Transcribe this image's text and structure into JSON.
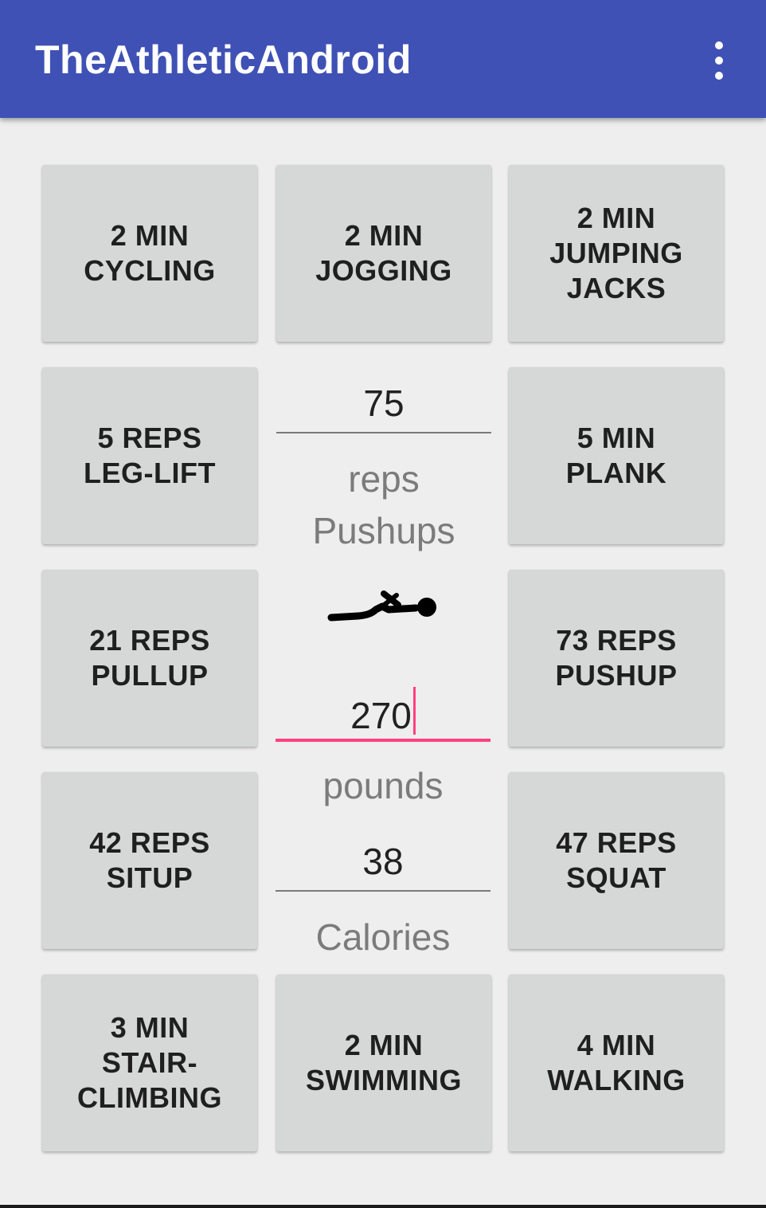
{
  "app_bar": {
    "title": "TheAthleticAndroid",
    "overflow_icon": "more-vert-icon"
  },
  "exercises": {
    "cycling": {
      "line1": "2 MIN",
      "line2": "CYCLING"
    },
    "jogging": {
      "line1": "2 MIN",
      "line2": "JOGGING"
    },
    "jumping": {
      "line1": "2 MIN",
      "line2": "JUMPING",
      "line3": "JACKS"
    },
    "leglift": {
      "line1": "5 REPS",
      "line2": "LEG-LIFT"
    },
    "plank": {
      "line1": "5 MIN",
      "line2": "PLANK"
    },
    "pullup": {
      "line1": "21 REPS",
      "line2": "PULLUP"
    },
    "pushup": {
      "line1": "73 REPS",
      "line2": "PUSHUP"
    },
    "situp": {
      "line1": "42 REPS",
      "line2": "SITUP"
    },
    "squat": {
      "line1": "47 REPS",
      "line2": "SQUAT"
    },
    "stair": {
      "line1": "3 MIN",
      "line2": "STAIR-",
      "line3": "CLIMBING"
    },
    "swimming": {
      "line1": "2 MIN",
      "line2": "SWIMMING"
    },
    "walking": {
      "line1": "4 MIN",
      "line2": "WALKING"
    }
  },
  "center": {
    "amount_value": "75",
    "amount_unit": "reps",
    "exercise_name": "Pushups",
    "exercise_icon": "pushup-figure-icon",
    "weight_value": "270",
    "weight_unit": "pounds",
    "calories_value": "38",
    "calories_label": "Calories"
  },
  "colors": {
    "app_bar": "#3f51b5",
    "accent": "#ff4081",
    "button_bg": "#d6d7d7",
    "background": "#eeeeee"
  }
}
